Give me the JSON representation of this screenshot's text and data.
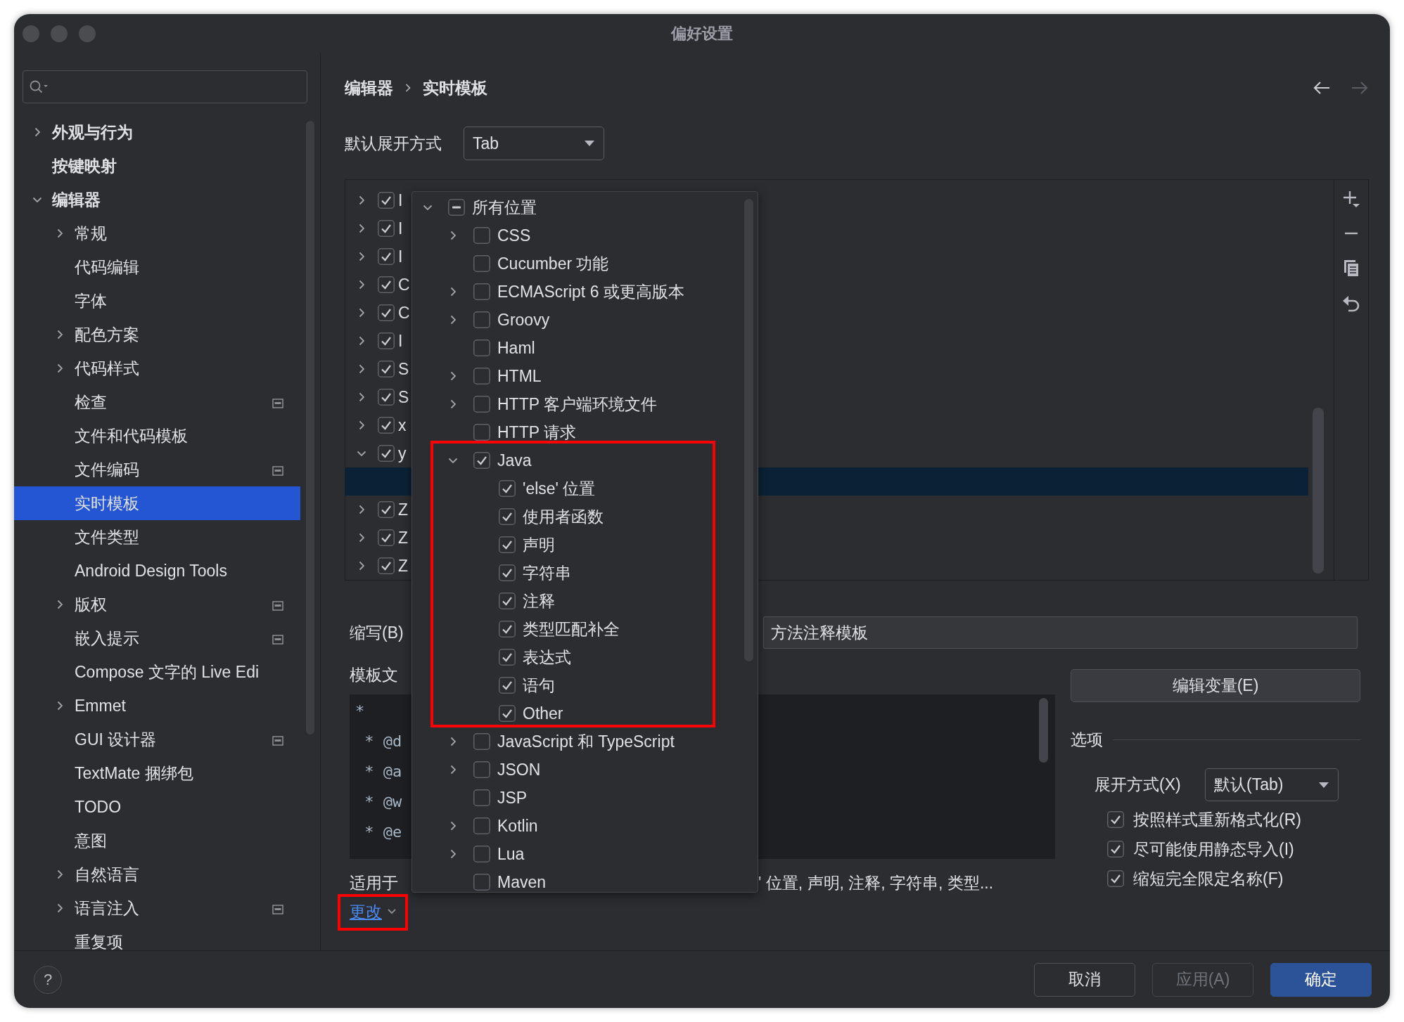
{
  "window": {
    "title": "偏好设置"
  },
  "sidebar": {
    "items": [
      {
        "label": "外观与行为",
        "kind": "group",
        "expanded": false,
        "selected": false,
        "project_scope": false
      },
      {
        "label": "按键映射",
        "kind": "page",
        "selected": false,
        "project_scope": false
      },
      {
        "label": "编辑器",
        "kind": "group",
        "expanded": true,
        "selected": false,
        "project_scope": false,
        "children": [
          {
            "label": "常规",
            "kind": "group",
            "expanded": false,
            "selected": false,
            "project_scope": false
          },
          {
            "label": "代码编辑",
            "kind": "page",
            "selected": false,
            "project_scope": false
          },
          {
            "label": "字体",
            "kind": "page",
            "selected": false,
            "project_scope": false
          },
          {
            "label": "配色方案",
            "kind": "group",
            "expanded": false,
            "selected": false,
            "project_scope": false
          },
          {
            "label": "代码样式",
            "kind": "group",
            "expanded": false,
            "selected": false,
            "project_scope": false
          },
          {
            "label": "检查",
            "kind": "page",
            "selected": false,
            "project_scope": true
          },
          {
            "label": "文件和代码模板",
            "kind": "page",
            "selected": false,
            "project_scope": false
          },
          {
            "label": "文件编码",
            "kind": "page",
            "selected": false,
            "project_scope": true
          },
          {
            "label": "实时模板",
            "kind": "page",
            "selected": true,
            "project_scope": false
          },
          {
            "label": "文件类型",
            "kind": "page",
            "selected": false,
            "project_scope": false
          },
          {
            "label": "Android Design Tools",
            "kind": "page",
            "selected": false,
            "project_scope": false
          },
          {
            "label": "版权",
            "kind": "group",
            "expanded": false,
            "selected": false,
            "project_scope": true
          },
          {
            "label": "嵌入提示",
            "kind": "page",
            "selected": false,
            "project_scope": true
          },
          {
            "label": "Compose 文字的 Live Edi",
            "kind": "page",
            "selected": false,
            "project_scope": false
          },
          {
            "label": "Emmet",
            "kind": "group",
            "expanded": false,
            "selected": false,
            "project_scope": false
          },
          {
            "label": "GUI 设计器",
            "kind": "page",
            "selected": false,
            "project_scope": true
          },
          {
            "label": "TextMate 捆绑包",
            "kind": "page",
            "selected": false,
            "project_scope": false
          },
          {
            "label": "TODO",
            "kind": "page",
            "selected": false,
            "project_scope": false
          },
          {
            "label": "意图",
            "kind": "page",
            "selected": false,
            "project_scope": false
          },
          {
            "label": "自然语言",
            "kind": "group",
            "expanded": false,
            "selected": false,
            "project_scope": false
          },
          {
            "label": "语言注入",
            "kind": "group",
            "expanded": false,
            "selected": false,
            "project_scope": true
          },
          {
            "label": "重复项",
            "kind": "page",
            "selected": false,
            "project_scope": false
          }
        ]
      }
    ]
  },
  "breadcrumb": [
    "编辑器",
    "实时模板"
  ],
  "nav_buttons": [
    {
      "kind": "back",
      "disabled": false
    },
    {
      "kind": "forward",
      "disabled": true
    }
  ],
  "expand_with": {
    "label": "默认展开方式",
    "value": "Tab"
  },
  "template_groups": [
    {
      "label": "I",
      "checked": true,
      "expanded": false,
      "selected": false
    },
    {
      "label": "I",
      "checked": true,
      "expanded": false,
      "selected": false
    },
    {
      "label": "I",
      "checked": true,
      "expanded": false,
      "selected": false
    },
    {
      "label": "C",
      "checked": true,
      "expanded": false,
      "selected": false
    },
    {
      "label": "C",
      "checked": true,
      "expanded": false,
      "selected": false
    },
    {
      "label": "I",
      "checked": true,
      "expanded": false,
      "selected": false
    },
    {
      "label": "S",
      "checked": true,
      "expanded": false,
      "selected": false
    },
    {
      "label": "S",
      "checked": true,
      "expanded": false,
      "selected": false
    },
    {
      "label": "x",
      "checked": true,
      "expanded": false,
      "selected": false
    },
    {
      "label": "y",
      "checked": true,
      "expanded": true,
      "selected": false,
      "children": [
        {
          "selected": true
        }
      ]
    },
    {
      "label": "Z",
      "checked": true,
      "expanded": false,
      "selected": false
    },
    {
      "label": "Z",
      "checked": true,
      "expanded": false,
      "selected": false
    },
    {
      "label": "Z",
      "checked": true,
      "expanded": false,
      "selected": false
    }
  ],
  "context_popup": {
    "items": [
      {
        "label": "所有位置",
        "kind": "group",
        "expanded": true,
        "checked": false,
        "partial": true,
        "children": [
          {
            "label": "CSS",
            "kind": "group",
            "expanded": false,
            "checked": false
          },
          {
            "label": "Cucumber 功能",
            "kind": "leaf",
            "checked": false
          },
          {
            "label": "ECMAScript 6 或更高版本",
            "kind": "group",
            "expanded": false,
            "checked": false
          },
          {
            "label": "Groovy",
            "kind": "group",
            "expanded": false,
            "checked": false
          },
          {
            "label": "Haml",
            "kind": "leaf",
            "checked": false
          },
          {
            "label": "HTML",
            "kind": "group",
            "expanded": false,
            "checked": false
          },
          {
            "label": "HTTP 客户端环境文件",
            "kind": "group",
            "expanded": false,
            "checked": false
          },
          {
            "label": "HTTP 请求",
            "kind": "leaf",
            "checked": false
          },
          {
            "label": "Java",
            "kind": "group",
            "expanded": true,
            "checked": true,
            "children": [
              {
                "label": "'else' 位置",
                "kind": "leaf",
                "checked": true
              },
              {
                "label": "使用者函数",
                "kind": "leaf",
                "checked": true
              },
              {
                "label": "声明",
                "kind": "leaf",
                "checked": true
              },
              {
                "label": "字符串",
                "kind": "leaf",
                "checked": true
              },
              {
                "label": "注释",
                "kind": "leaf",
                "checked": true
              },
              {
                "label": "类型匹配补全",
                "kind": "leaf",
                "checked": true
              },
              {
                "label": "表达式",
                "kind": "leaf",
                "checked": true
              },
              {
                "label": "语句",
                "kind": "leaf",
                "checked": true
              },
              {
                "label": "Other",
                "kind": "leaf",
                "checked": true
              }
            ]
          },
          {
            "label": "JavaScript 和 TypeScript",
            "kind": "group",
            "expanded": false,
            "checked": false
          },
          {
            "label": "JSON",
            "kind": "group",
            "expanded": false,
            "checked": false
          },
          {
            "label": "JSP",
            "kind": "leaf",
            "checked": false
          },
          {
            "label": "Kotlin",
            "kind": "group",
            "expanded": false,
            "checked": false
          },
          {
            "label": "Lua",
            "kind": "group",
            "expanded": false,
            "checked": false
          },
          {
            "label": "Maven",
            "kind": "leaf",
            "checked": false
          }
        ]
      }
    ]
  },
  "abbreviation": {
    "label": "缩写(B)"
  },
  "description": {
    "value": "方法注释模板"
  },
  "template_text": {
    "label": "模板文",
    "lines": [
      "*",
      " * @d",
      " * @a",
      " * @w",
      " * @e"
    ]
  },
  "edit_variables_button": {
    "label": "编辑变量(E)"
  },
  "options": {
    "title": "选项",
    "expand_label": "展开方式(X)",
    "expand_value": "默认(Tab)",
    "checkboxes": [
      {
        "label": "按照样式重新格式化(R)",
        "checked": true
      },
      {
        "label": "尽可能使用静态导入(I)",
        "checked": true
      },
      {
        "label": "缩短完全限定名称(F)",
        "checked": true
      }
    ]
  },
  "applicable": {
    "label": "适用于",
    "summary": "' 位置, 声明, 注释, 字符串, 类型...",
    "change_link": "更改"
  },
  "footer": {
    "help": "?",
    "buttons": [
      {
        "label": "取消",
        "kind": "normal",
        "disabled": false
      },
      {
        "label": "应用(A)",
        "kind": "normal",
        "disabled": true
      },
      {
        "label": "确定",
        "kind": "primary",
        "disabled": false
      }
    ]
  }
}
